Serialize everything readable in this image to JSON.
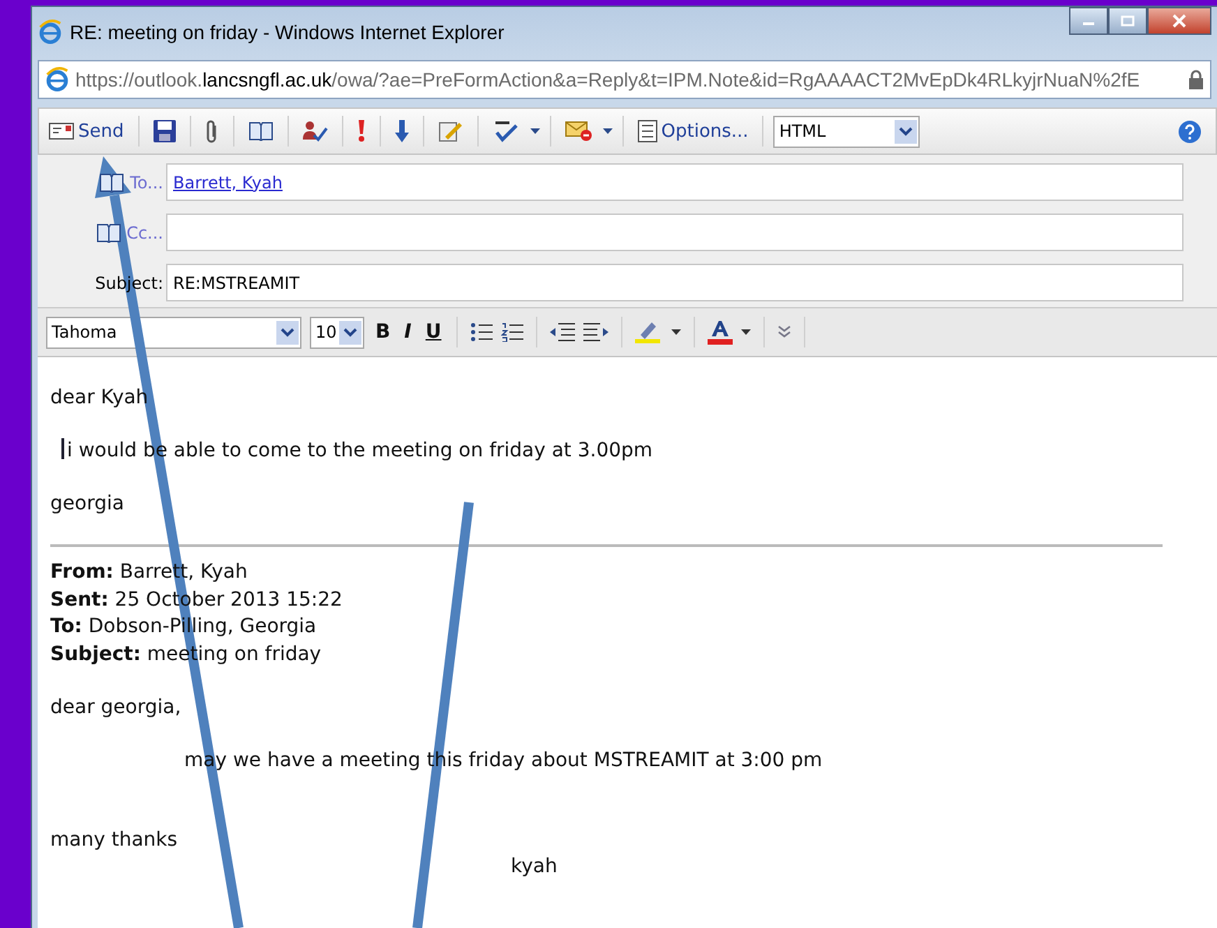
{
  "window": {
    "title": "RE: meeting on friday - Windows Internet Explorer"
  },
  "address_bar": {
    "url_host_prefix": "https://outlook.",
    "url_host": "lancsngfl.ac.uk",
    "url_path": "/owa/?ae=PreFormAction&a=Reply&t=IPM.Note&id=RgAAAACT2MvEpDk4RLkyjrNuaN%2fE"
  },
  "toolbar": [
    {
      "kind": "send",
      "label": "Send"
    },
    {
      "kind": "save"
    },
    {
      "kind": "attach"
    },
    {
      "kind": "book"
    },
    {
      "kind": "names"
    },
    {
      "kind": "high"
    },
    {
      "kind": "low"
    },
    {
      "kind": "sign"
    },
    {
      "kind": "spell",
      "dropdown": true
    },
    {
      "kind": "flag",
      "dropdown": true
    },
    {
      "kind": "options",
      "label": "Options..."
    }
  ],
  "format_select": {
    "value": "HTML"
  },
  "fields": [
    {
      "kind": "to",
      "label": "To...",
      "value": "Barrett, Kyah"
    },
    {
      "kind": "cc",
      "label": "Cc..."
    },
    {
      "kind": "subject",
      "label": "Subject:",
      "value": "RE:MSTREAMIT"
    }
  ],
  "format_bar": {
    "font": "Tahoma",
    "size": "10",
    "buttons": [
      "B",
      "I",
      "U"
    ]
  },
  "body": {
    "lines": [
      "dear Kyah",
      "i would be able to come to the meeting on friday at 3.00pm",
      "georgia"
    ],
    "quoted_header": [
      {
        "label": "From:",
        "value": "Barrett, Kyah"
      },
      {
        "label": "Sent:",
        "value": "25 October 2013 15:22"
      },
      {
        "label": "To:",
        "value": "Dobson-Pilling, Georgia"
      },
      {
        "label": "Subject:",
        "value": "meeting on friday"
      }
    ],
    "quoted_lines": [
      {
        "kind": "plain",
        "text": "dear georgia,"
      },
      {
        "kind": "indent",
        "text": "may we have a meeting this friday about MSTREAMIT at 3:00 pm"
      },
      {
        "kind": "plain",
        "text": "many thanks"
      },
      {
        "kind": "signature",
        "text": "kyah"
      }
    ]
  }
}
